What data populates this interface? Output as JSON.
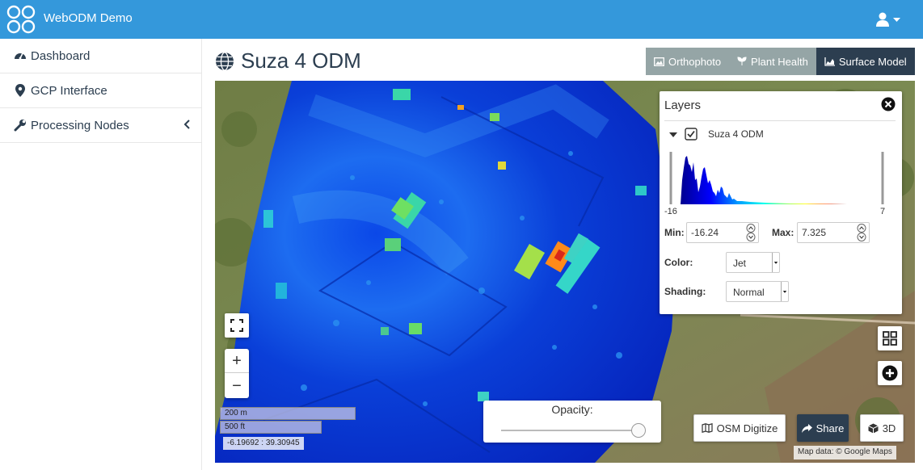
{
  "app": {
    "brand": "WebODM Demo"
  },
  "sidebar": {
    "items": [
      {
        "label": "Dashboard",
        "icon": "dashboard-icon"
      },
      {
        "label": "GCP Interface",
        "icon": "map-marker-icon"
      },
      {
        "label": "Processing Nodes",
        "icon": "wrench-icon",
        "chevron": "chevron-left-icon"
      }
    ]
  },
  "page": {
    "title": "Suza 4 ODM",
    "title_icon": "globe-icon"
  },
  "view_tabs": [
    {
      "label": "Orthophoto",
      "icon": "image-icon",
      "active": false
    },
    {
      "label": "Plant Health",
      "icon": "leaf-icon",
      "active": false
    },
    {
      "label": "Surface Model",
      "icon": "area-chart-icon",
      "active": true
    }
  ],
  "layers_panel": {
    "title": "Layers",
    "layer_name": "Suza 4 ODM",
    "checked": true,
    "histogram": {
      "min_label": "-16",
      "max_label": "7"
    },
    "min_label": "Min:",
    "min_value": "-16.24",
    "max_label": "Max:",
    "max_value": "7.325",
    "color_label": "Color:",
    "color_value": "Jet",
    "shading_label": "Shading:",
    "shading_value": "Normal"
  },
  "map": {
    "zoom_in": "+",
    "zoom_out": "−",
    "scale_metric": "200 m",
    "scale_imperial": "500 ft",
    "coordinates": "-6.19692 : 39.30945",
    "opacity_label": "Opacity:",
    "opacity": 1.0,
    "attribution": "Map data: © Google Maps"
  },
  "actions": {
    "osm": "OSM Digitize",
    "share": "Share",
    "view3d": "3D"
  },
  "colors": {
    "brand": "#3498db",
    "active_tab": "#2c3e50",
    "inactive_tab": "#95a5a6",
    "share_button": "#2c3e50"
  }
}
